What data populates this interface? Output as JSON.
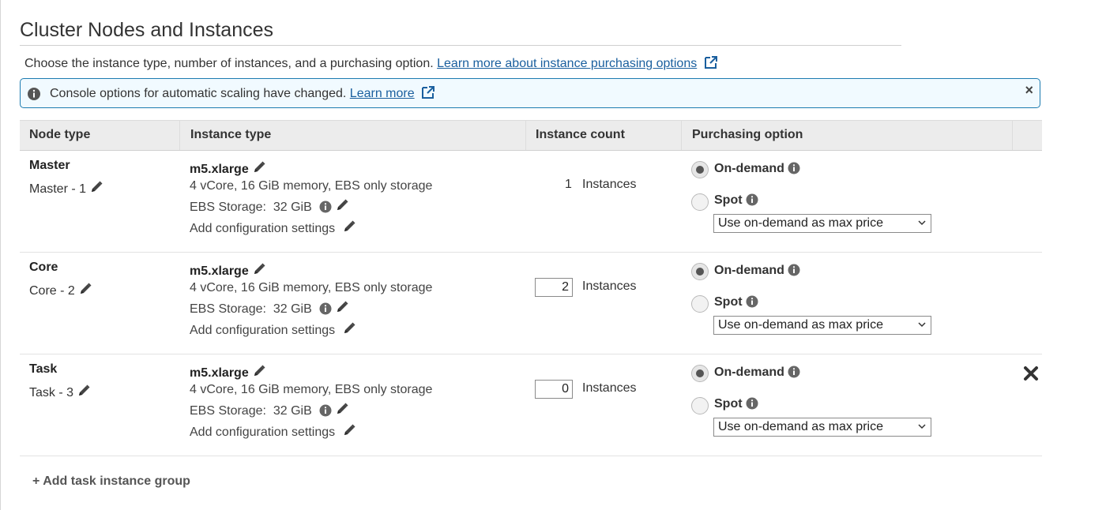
{
  "section": {
    "title": "Cluster Nodes and Instances",
    "description": "Choose the instance type, number of instances, and a purchasing option.",
    "learn_more_link": "Learn more about instance purchasing options"
  },
  "banner": {
    "text": "Console options for automatic scaling have changed.",
    "link": "Learn more",
    "close": "×"
  },
  "table": {
    "headers": {
      "node_type": "Node type",
      "instance_type": "Instance type",
      "instance_count": "Instance count",
      "purchasing_option": "Purchasing option"
    },
    "rows": [
      {
        "node_type": "Master",
        "node_name": "Master - 1",
        "instance_type": "m5.xlarge",
        "spec": "4 vCore, 16 GiB memory, EBS only storage",
        "ebs": "EBS Storage:  32 GiB",
        "add_config": "Add configuration settings",
        "count": "1",
        "count_unit": "Instances",
        "on_demand": "On-demand",
        "spot": "Spot",
        "selected": "on-demand",
        "spot_price": "Use on-demand as max price"
      },
      {
        "node_type": "Core",
        "node_name": "Core - 2",
        "instance_type": "m5.xlarge",
        "spec": "4 vCore, 16 GiB memory, EBS only storage",
        "ebs": "EBS Storage:  32 GiB",
        "add_config": "Add configuration settings",
        "count": "2",
        "count_unit": "Instances",
        "on_demand": "On-demand",
        "spot": "Spot",
        "selected": "on-demand",
        "spot_price": "Use on-demand as max price"
      },
      {
        "node_type": "Task",
        "node_name": "Task - 3",
        "instance_type": "m5.xlarge",
        "spec": "4 vCore, 16 GiB memory, EBS only storage",
        "ebs": "EBS Storage:  32 GiB",
        "add_config": "Add configuration settings",
        "count": "0",
        "count_unit": "Instances",
        "on_demand": "On-demand",
        "spot": "Spot",
        "selected": "on-demand",
        "spot_price": "Use on-demand as max price"
      }
    ]
  },
  "add_task_group": "+ Add task instance group",
  "colors": {
    "link": "#1a5f9e",
    "banner_border": "#1c7bb0",
    "banner_bg": "#f1faff",
    "header_bg": "#ececec"
  }
}
